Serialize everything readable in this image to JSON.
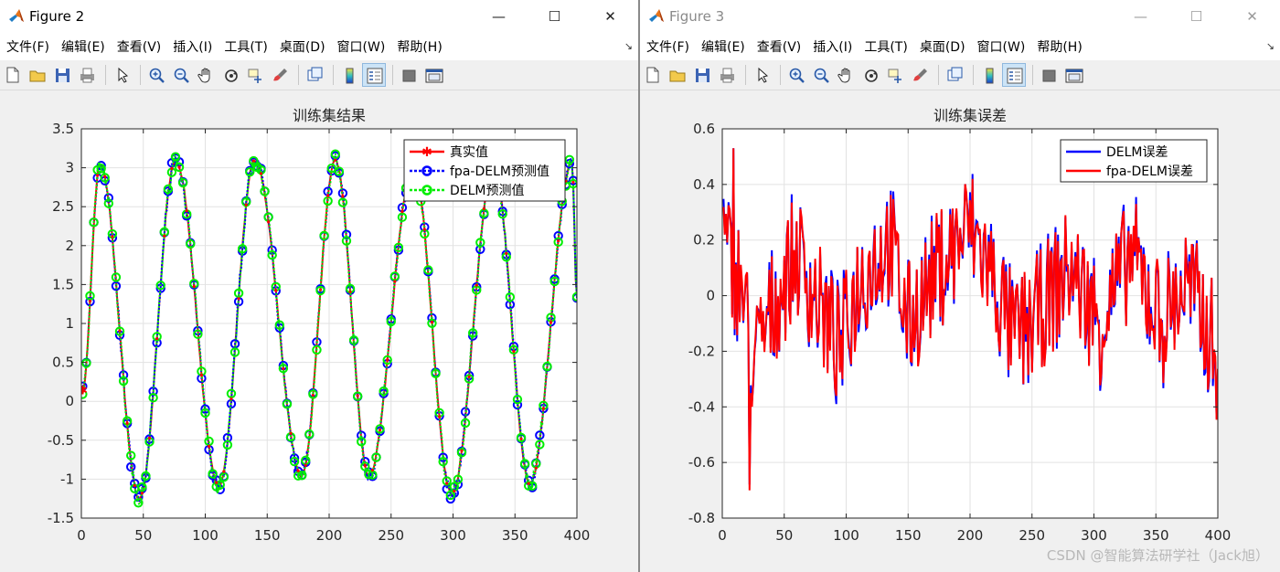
{
  "figure2": {
    "title": "Figure 2",
    "menus": [
      "文件(F)",
      "编辑(E)",
      "查看(V)",
      "插入(I)",
      "工具(T)",
      "桌面(D)",
      "窗口(W)",
      "帮助(H)"
    ],
    "menu_corner": "↘",
    "controls": {
      "minimize": "—",
      "maximize": "☐",
      "close": "✕"
    }
  },
  "figure3": {
    "title": "Figure 3",
    "menus": [
      "文件(F)",
      "编辑(E)",
      "查看(V)",
      "插入(I)",
      "工具(T)",
      "桌面(D)",
      "窗口(W)",
      "帮助(H)"
    ],
    "menu_corner": "↘",
    "controls": {
      "minimize": "—",
      "maximize": "☐",
      "close": "✕"
    }
  },
  "toolbar_icons": [
    "new-file-icon",
    "open-file-icon",
    "save-icon",
    "print-icon",
    "|",
    "pointer-icon",
    "|",
    "zoom-in-icon",
    "zoom-out-icon",
    "pan-hand-icon",
    "rotate-3d-icon",
    "data-cursor-icon",
    "brush-icon",
    "|",
    "link-plot-icon",
    "|",
    "colorbar-icon",
    "legend-icon",
    "|",
    "hide-plot-tools-icon",
    "show-plot-tools-icon"
  ],
  "watermark": "CSDN @智能算法研学社（Jack旭）",
  "colors": {
    "red": "#ff0000",
    "blue": "#0000ff",
    "green": "#00ee00",
    "grid": "#e2e2e2"
  },
  "chart_data": [
    {
      "type": "line",
      "title": "训练集结果",
      "xlabel": "",
      "ylabel": "",
      "xlim": [
        0,
        400
      ],
      "ylim": [
        -1.5,
        3.5
      ],
      "xticks": [
        0,
        50,
        100,
        150,
        200,
        250,
        300,
        350,
        400
      ],
      "yticks": [
        -1.5,
        -1,
        -0.5,
        0,
        0.5,
        1,
        1.5,
        2,
        2.5,
        3,
        3.5
      ],
      "yticklabels": [
        "-1.5",
        "-1",
        "-0.5",
        "0",
        "0.5",
        "1",
        "1.5",
        "2",
        "2.5",
        "3",
        "3.5"
      ],
      "grid": true,
      "legend_position": "top-right",
      "shape": {
        "description": "periodic signal sampled at x = 1..400, period ≈ 65",
        "x": [
          1,
          15,
          47,
          76,
          111,
          140,
          178,
          205,
          232,
          268,
          299,
          333,
          362,
          396,
          400
        ],
        "y": [
          0.15,
          3.05,
          -1.25,
          3.1,
          -1.1,
          3.1,
          -0.95,
          3.1,
          -0.95,
          3.0,
          -1.2,
          3.0,
          -1.05,
          3.05,
          1.35
        ]
      },
      "series": [
        {
          "name": "真实值",
          "style": "solid line with star markers",
          "color": "#ff0000"
        },
        {
          "name": "fpa-DELM预测值",
          "style": "dotted line with circle markers",
          "color": "#0000ff"
        },
        {
          "name": "DELM预测值",
          "style": "dotted line with circle markers",
          "color": "#00ee00"
        }
      ]
    },
    {
      "type": "line",
      "title": "训练集误差",
      "xlabel": "",
      "ylabel": "",
      "xlim": [
        0,
        400
      ],
      "ylim": [
        -0.8,
        0.6
      ],
      "xticks": [
        0,
        50,
        100,
        150,
        200,
        250,
        300,
        350,
        400
      ],
      "yticks": [
        -0.8,
        -0.6,
        -0.4,
        -0.2,
        0,
        0.2,
        0.4,
        0.6
      ],
      "yticklabels": [
        "-0.8",
        "-0.6",
        "-0.4",
        "-0.2",
        "0",
        "0.2",
        "0.4",
        "0.6"
      ],
      "grid": true,
      "legend_position": "top-right",
      "range_observed": {
        "min": -0.7,
        "max": 0.53,
        "min_at_x": 22,
        "max_at_x": 9
      },
      "series": [
        {
          "name": "DELM误差",
          "style": "solid line",
          "color": "#0000ff"
        },
        {
          "name": "fpa-DELM误差",
          "style": "solid line",
          "color": "#ff0000"
        }
      ]
    }
  ]
}
